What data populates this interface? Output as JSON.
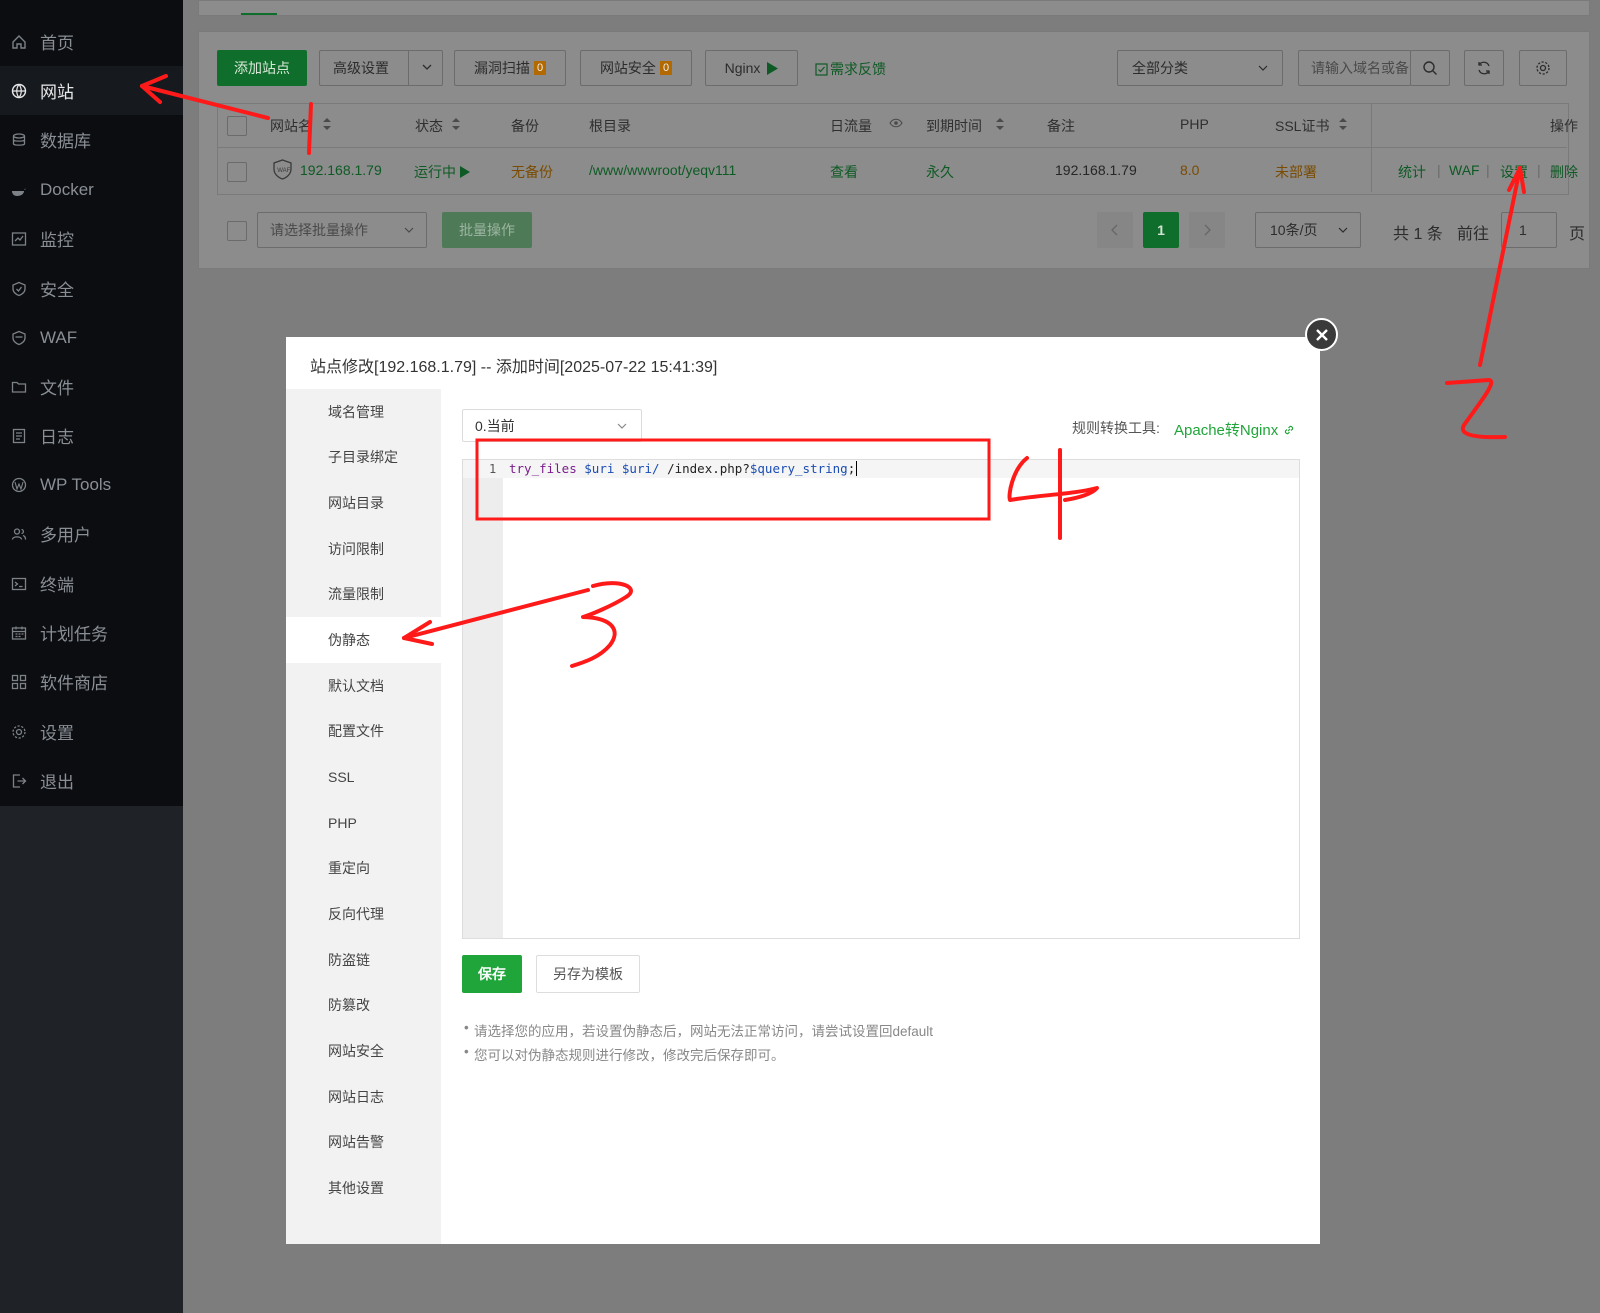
{
  "sidebar": {
    "items": [
      {
        "label": "首页",
        "icon": "home-icon"
      },
      {
        "label": "网站",
        "icon": "globe-icon"
      },
      {
        "label": "数据库",
        "icon": "database-icon"
      },
      {
        "label": "Docker",
        "icon": "docker-icon"
      },
      {
        "label": "监控",
        "icon": "monitor-icon"
      },
      {
        "label": "安全",
        "icon": "shield-icon"
      },
      {
        "label": "WAF",
        "icon": "waf-shield-icon"
      },
      {
        "label": "文件",
        "icon": "folder-icon"
      },
      {
        "label": "日志",
        "icon": "log-icon"
      },
      {
        "label": "WP Tools",
        "icon": "wordpress-icon"
      },
      {
        "label": "多用户",
        "icon": "users-icon"
      },
      {
        "label": "终端",
        "icon": "terminal-icon"
      },
      {
        "label": "计划任务",
        "icon": "calendar-icon"
      },
      {
        "label": "软件商店",
        "icon": "apps-icon"
      },
      {
        "label": "设置",
        "icon": "gear-icon"
      },
      {
        "label": "退出",
        "icon": "logout-icon"
      }
    ]
  },
  "toolbar": {
    "add_site": "添加站点",
    "advanced": "高级设置",
    "vuln_scan": "漏洞扫描",
    "vuln_count": "0",
    "site_security": "网站安全",
    "security_count": "0",
    "nginx": "Nginx",
    "feedback": "需求反馈",
    "category": "全部分类",
    "search_placeholder": "请输入域名或备注"
  },
  "table": {
    "headers": {
      "name": "网站名",
      "status": "状态",
      "backup": "备份",
      "root": "根目录",
      "traffic": "日流量",
      "expire": "到期时间",
      "note": "备注",
      "php": "PHP",
      "ssl": "SSL证书",
      "ops": "操作"
    },
    "row": {
      "name": "192.168.1.79",
      "status": "运行中",
      "backup": "无备份",
      "root": "/www/wwwroot/yeqv111",
      "traffic": "查看",
      "expire": "永久",
      "note": "192.168.1.79",
      "php": "8.0",
      "ssl": "未部署",
      "op_stats": "统计",
      "op_waf": "WAF",
      "op_settings": "设置",
      "op_delete": "删除"
    }
  },
  "batch": {
    "placeholder": "请选择批量操作",
    "button": "批量操作"
  },
  "pagination": {
    "current": "1",
    "page_size": "10条/页",
    "total": "共 1 条",
    "goto_label": "前往",
    "goto_value": "1",
    "page_label": "页"
  },
  "modal": {
    "title": "站点修改[192.168.1.79] -- 添加时间[2025-07-22 15:41:39]",
    "nav": [
      "域名管理",
      "子目录绑定",
      "网站目录",
      "访问限制",
      "流量限制",
      "伪静态",
      "默认文档",
      "配置文件",
      "SSL",
      "PHP",
      "重定向",
      "反向代理",
      "防盗链",
      "防篡改",
      "网站安全",
      "网站日志",
      "网站告警",
      "其他设置"
    ],
    "active_nav": "伪静态",
    "version_select": "0.当前",
    "tool_label": "规则转换工具:",
    "tool_link": "Apache转Nginx",
    "line_number": "1",
    "code": {
      "kw": "try_files",
      "v1": "$uri",
      "v2": "$uri/",
      "path": "/index.php?",
      "v3": "$query_string",
      "end": ";"
    },
    "save": "保存",
    "save_template": "另存为模板",
    "tips": [
      "请选择您的应用，若设置伪静态后，网站无法正常访问，请尝试设置回default",
      "您可以对伪静态规则进行修改，修改完后保存即可。"
    ]
  },
  "annotations": {
    "mark2": "2",
    "mark3": "3",
    "mark4": "4"
  },
  "colors": {
    "accent": "#20a53a",
    "annotation": "#ff1a1a",
    "sidebar_bg": "#0b0d10"
  }
}
